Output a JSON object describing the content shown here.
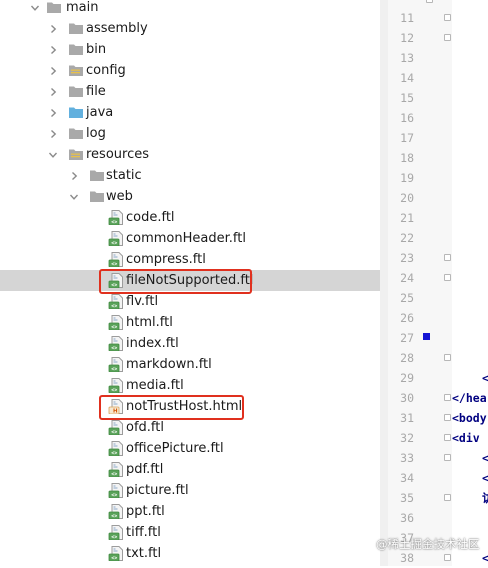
{
  "tree": {
    "rows": [
      {
        "name": "main",
        "kind": "folder",
        "expanded": true,
        "depth": 0
      },
      {
        "name": "assembly",
        "kind": "folder",
        "expanded": false,
        "depth": 1
      },
      {
        "name": "bin",
        "kind": "folder",
        "expanded": false,
        "depth": 1
      },
      {
        "name": "config",
        "kind": "resource-folder",
        "expanded": false,
        "depth": 1
      },
      {
        "name": "file",
        "kind": "folder",
        "expanded": false,
        "depth": 1
      },
      {
        "name": "java",
        "kind": "source-folder",
        "expanded": false,
        "depth": 1
      },
      {
        "name": "log",
        "kind": "folder",
        "expanded": false,
        "depth": 1
      },
      {
        "name": "resources",
        "kind": "resource-folder",
        "expanded": true,
        "depth": 1
      },
      {
        "name": "static",
        "kind": "folder",
        "expanded": false,
        "depth": 2
      },
      {
        "name": "web",
        "kind": "folder",
        "expanded": true,
        "depth": 2
      },
      {
        "name": "code.ftl",
        "kind": "ftl",
        "depth": 3
      },
      {
        "name": "commonHeader.ftl",
        "kind": "ftl",
        "depth": 3
      },
      {
        "name": "compress.ftl",
        "kind": "ftl",
        "depth": 3
      },
      {
        "name": "fileNotSupported.ftl",
        "kind": "ftl",
        "depth": 3,
        "selected": true,
        "highlighted": true
      },
      {
        "name": "flv.ftl",
        "kind": "ftl",
        "depth": 3
      },
      {
        "name": "html.ftl",
        "kind": "ftl",
        "depth": 3
      },
      {
        "name": "index.ftl",
        "kind": "ftl",
        "depth": 3
      },
      {
        "name": "markdown.ftl",
        "kind": "ftl",
        "depth": 3
      },
      {
        "name": "media.ftl",
        "kind": "ftl",
        "depth": 3
      },
      {
        "name": "notTrustHost.html",
        "kind": "html",
        "depth": 3,
        "highlighted": true
      },
      {
        "name": "ofd.ftl",
        "kind": "ftl",
        "depth": 3
      },
      {
        "name": "officePicture.ftl",
        "kind": "ftl",
        "depth": 3
      },
      {
        "name": "pdf.ftl",
        "kind": "ftl",
        "depth": 3
      },
      {
        "name": "picture.ftl",
        "kind": "ftl",
        "depth": 3
      },
      {
        "name": "ppt.ftl",
        "kind": "ftl",
        "depth": 3
      },
      {
        "name": "tiff.ftl",
        "kind": "ftl",
        "depth": 3
      },
      {
        "name": "txt.ftl",
        "kind": "ftl",
        "depth": 3
      }
    ]
  },
  "gutter": {
    "line_numbers": [
      "11",
      "12",
      "13",
      "14",
      "15",
      "16",
      "17",
      "18",
      "19",
      "20",
      "21",
      "22",
      "23",
      "24",
      "25",
      "26",
      "27",
      "28",
      "29",
      "30",
      "31",
      "32",
      "33",
      "34",
      "35",
      "36",
      "37",
      "38"
    ],
    "fold_markers_on": [
      "11",
      "12",
      "23",
      "24",
      "28",
      "30",
      "31",
      "32",
      "33",
      "35",
      "38"
    ],
    "bookmark_on": "27"
  },
  "editor": {
    "lines": [
      {
        "line": "29",
        "text": "<"
      },
      {
        "line": "30",
        "text": "</hea"
      },
      {
        "line": "31",
        "text": "<body"
      },
      {
        "line": "32",
        "text": "<div"
      },
      {
        "line": "33",
        "text": "<"
      },
      {
        "line": "34",
        "text": "<"
      },
      {
        "line": "35",
        "text": "访"
      },
      {
        "line": "38",
        "text": "<"
      }
    ]
  },
  "watermark": "@稀土掘金技术社区",
  "colors": {
    "selection": "#d5d5d5",
    "highlight_box": "#e0301e",
    "folder": "#a9a9a9",
    "source_folder": "#62b0de",
    "ftl_icon": "#5aa25a",
    "bookmark": "#1414d4",
    "code_keyword": "#000080"
  }
}
